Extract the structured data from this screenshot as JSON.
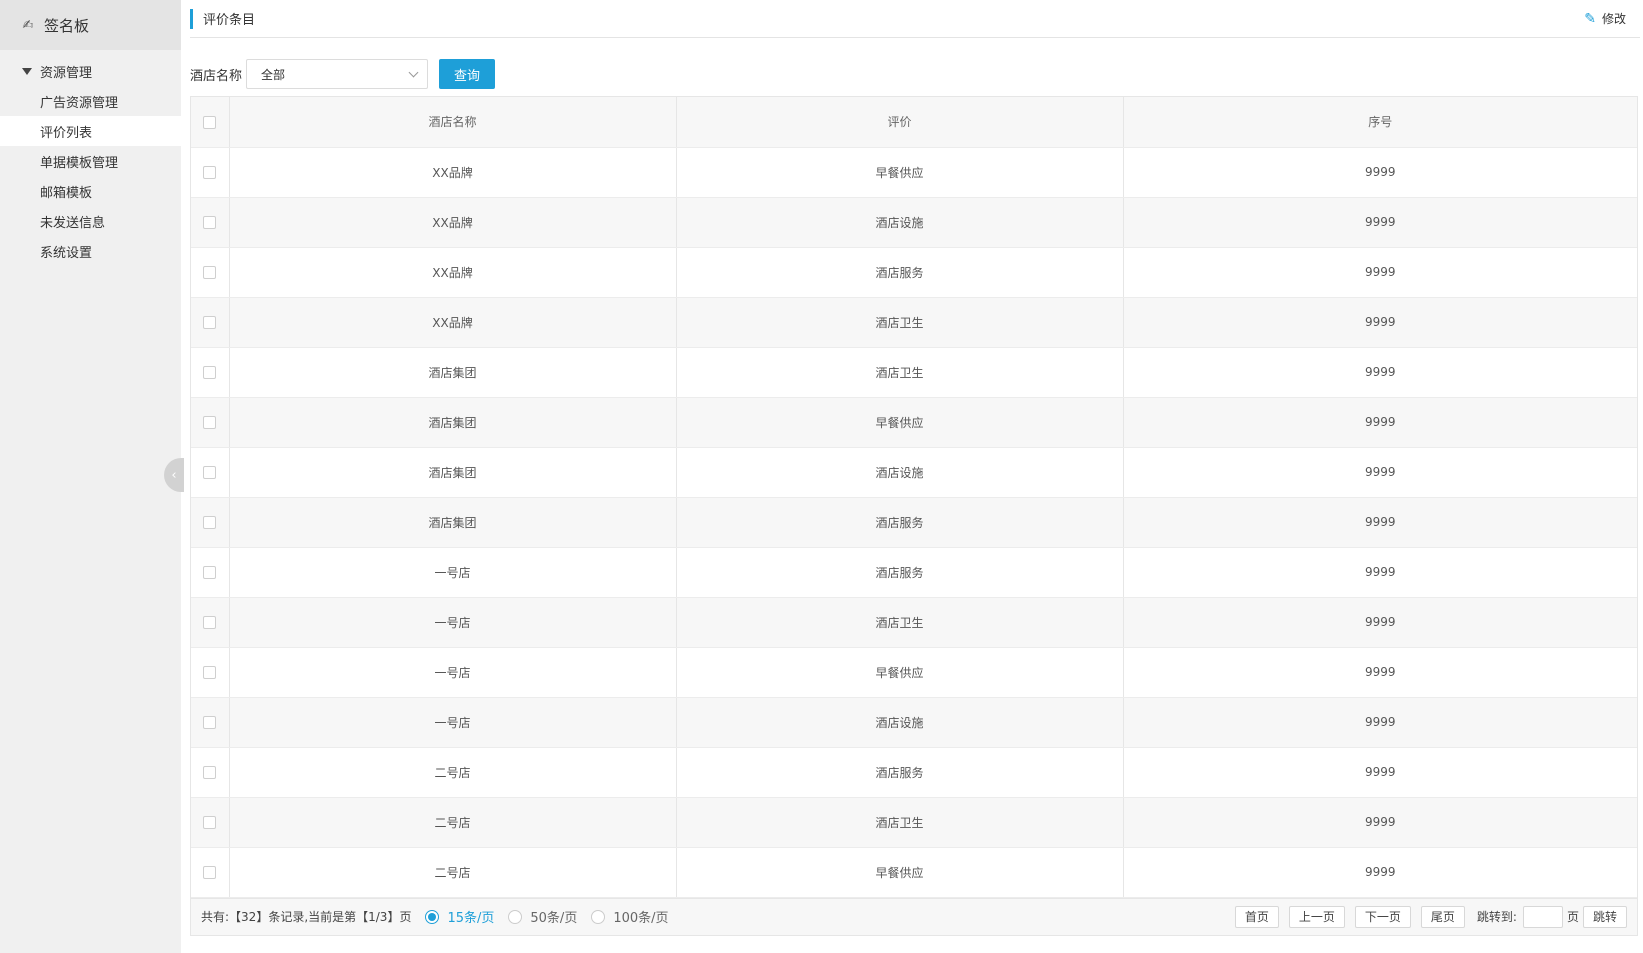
{
  "sidebar": {
    "brand_icon": "✍",
    "brand_title": "签名板",
    "group_label": "资源管理",
    "items": [
      {
        "label": "广告资源管理"
      },
      {
        "label": "评价列表"
      },
      {
        "label": "单据模板管理"
      },
      {
        "label": "邮箱模板"
      },
      {
        "label": "未发送信息"
      },
      {
        "label": "系统设置"
      }
    ],
    "active_index": 1,
    "collapse_glyph": "‹"
  },
  "header": {
    "title": "评价条目",
    "edit_label": "修改",
    "edit_icon": "✎"
  },
  "filter": {
    "label": "酒店名称",
    "select_value": "全部",
    "query_label": "查询"
  },
  "table": {
    "columns": [
      "酒店名称",
      "评价",
      "序号"
    ],
    "rows": [
      [
        "XX品牌",
        "早餐供应",
        "9999"
      ],
      [
        "XX品牌",
        "酒店设施",
        "9999"
      ],
      [
        "XX品牌",
        "酒店服务",
        "9999"
      ],
      [
        "XX品牌",
        "酒店卫生",
        "9999"
      ],
      [
        "酒店集团",
        "酒店卫生",
        "9999"
      ],
      [
        "酒店集团",
        "早餐供应",
        "9999"
      ],
      [
        "酒店集团",
        "酒店设施",
        "9999"
      ],
      [
        "酒店集团",
        "酒店服务",
        "9999"
      ],
      [
        "一号店",
        "酒店服务",
        "9999"
      ],
      [
        "一号店",
        "酒店卫生",
        "9999"
      ],
      [
        "一号店",
        "早餐供应",
        "9999"
      ],
      [
        "一号店",
        "酒店设施",
        "9999"
      ],
      [
        "二号店",
        "酒店服务",
        "9999"
      ],
      [
        "二号店",
        "酒店卫生",
        "9999"
      ],
      [
        "二号店",
        "早餐供应",
        "9999"
      ]
    ]
  },
  "pagination": {
    "summary": "共有:【32】条记录,当前是第【1/3】页",
    "page_sizes": [
      "15条/页",
      "50条/页",
      "100条/页"
    ],
    "selected_size_index": 0,
    "first": "首页",
    "prev": "上一页",
    "next": "下一页",
    "last": "尾页",
    "jump_label": "跳转到:",
    "page_suffix": "页",
    "jump_button": "跳转"
  }
}
